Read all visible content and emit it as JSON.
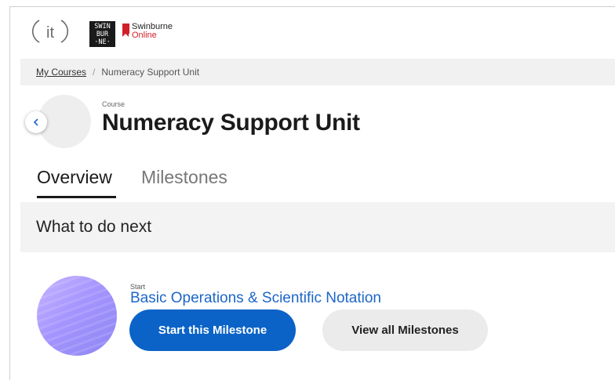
{
  "header": {
    "it_logo_text": "it",
    "swinburne_mark": [
      "SWIN",
      "BUR",
      "·NE·"
    ],
    "swinburne_name": "Swinburne",
    "swinburne_online": "Online"
  },
  "breadcrumb": {
    "root_label": "My Courses",
    "separator": "/",
    "current_label": "Numeracy Support Unit"
  },
  "course": {
    "label": "Course",
    "title": "Numeracy Support Unit"
  },
  "tabs": [
    {
      "label": "Overview",
      "active": true
    },
    {
      "label": "Milestones",
      "active": false
    }
  ],
  "next_section": {
    "heading": "What to do next"
  },
  "milestone": {
    "status_label": "Start",
    "title": "Basic Operations & Scientific Notation",
    "start_button_label": "Start this Milestone",
    "view_all_button_label": "View all Milestones"
  },
  "colors": {
    "primary": "#0b63c7",
    "link": "#1b66c9",
    "brand_red": "#d0202a"
  }
}
